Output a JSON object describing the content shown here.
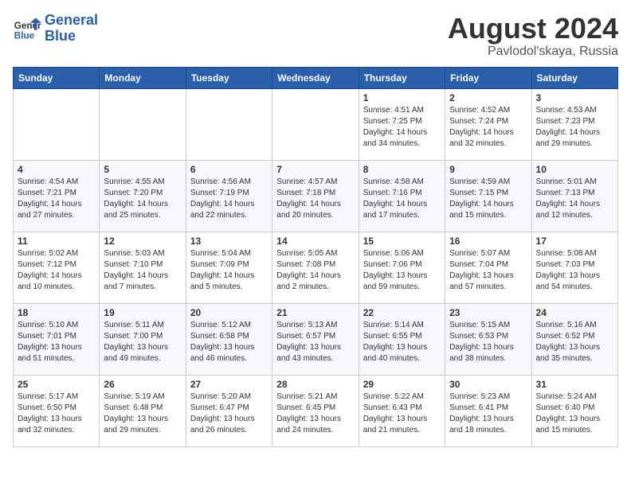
{
  "logo": {
    "text_general": "General",
    "text_blue": "Blue"
  },
  "title": "August 2024",
  "location": "Pavlodol'skaya, Russia",
  "days_of_week": [
    "Sunday",
    "Monday",
    "Tuesday",
    "Wednesday",
    "Thursday",
    "Friday",
    "Saturday"
  ],
  "weeks": [
    [
      {
        "day": "",
        "sunrise": "",
        "sunset": "",
        "daylight": ""
      },
      {
        "day": "",
        "sunrise": "",
        "sunset": "",
        "daylight": ""
      },
      {
        "day": "",
        "sunrise": "",
        "sunset": "",
        "daylight": ""
      },
      {
        "day": "",
        "sunrise": "",
        "sunset": "",
        "daylight": ""
      },
      {
        "day": "1",
        "sunrise": "Sunrise: 4:51 AM",
        "sunset": "Sunset: 7:25 PM",
        "daylight": "Daylight: 14 hours and 34 minutes."
      },
      {
        "day": "2",
        "sunrise": "Sunrise: 4:52 AM",
        "sunset": "Sunset: 7:24 PM",
        "daylight": "Daylight: 14 hours and 32 minutes."
      },
      {
        "day": "3",
        "sunrise": "Sunrise: 4:53 AM",
        "sunset": "Sunset: 7:23 PM",
        "daylight": "Daylight: 14 hours and 29 minutes."
      }
    ],
    [
      {
        "day": "4",
        "sunrise": "Sunrise: 4:54 AM",
        "sunset": "Sunset: 7:21 PM",
        "daylight": "Daylight: 14 hours and 27 minutes."
      },
      {
        "day": "5",
        "sunrise": "Sunrise: 4:55 AM",
        "sunset": "Sunset: 7:20 PM",
        "daylight": "Daylight: 14 hours and 25 minutes."
      },
      {
        "day": "6",
        "sunrise": "Sunrise: 4:56 AM",
        "sunset": "Sunset: 7:19 PM",
        "daylight": "Daylight: 14 hours and 22 minutes."
      },
      {
        "day": "7",
        "sunrise": "Sunrise: 4:57 AM",
        "sunset": "Sunset: 7:18 PM",
        "daylight": "Daylight: 14 hours and 20 minutes."
      },
      {
        "day": "8",
        "sunrise": "Sunrise: 4:58 AM",
        "sunset": "Sunset: 7:16 PM",
        "daylight": "Daylight: 14 hours and 17 minutes."
      },
      {
        "day": "9",
        "sunrise": "Sunrise: 4:59 AM",
        "sunset": "Sunset: 7:15 PM",
        "daylight": "Daylight: 14 hours and 15 minutes."
      },
      {
        "day": "10",
        "sunrise": "Sunrise: 5:01 AM",
        "sunset": "Sunset: 7:13 PM",
        "daylight": "Daylight: 14 hours and 12 minutes."
      }
    ],
    [
      {
        "day": "11",
        "sunrise": "Sunrise: 5:02 AM",
        "sunset": "Sunset: 7:12 PM",
        "daylight": "Daylight: 14 hours and 10 minutes."
      },
      {
        "day": "12",
        "sunrise": "Sunrise: 5:03 AM",
        "sunset": "Sunset: 7:10 PM",
        "daylight": "Daylight: 14 hours and 7 minutes."
      },
      {
        "day": "13",
        "sunrise": "Sunrise: 5:04 AM",
        "sunset": "Sunset: 7:09 PM",
        "daylight": "Daylight: 14 hours and 5 minutes."
      },
      {
        "day": "14",
        "sunrise": "Sunrise: 5:05 AM",
        "sunset": "Sunset: 7:08 PM",
        "daylight": "Daylight: 14 hours and 2 minutes."
      },
      {
        "day": "15",
        "sunrise": "Sunrise: 5:06 AM",
        "sunset": "Sunset: 7:06 PM",
        "daylight": "Daylight: 13 hours and 59 minutes."
      },
      {
        "day": "16",
        "sunrise": "Sunrise: 5:07 AM",
        "sunset": "Sunset: 7:04 PM",
        "daylight": "Daylight: 13 hours and 57 minutes."
      },
      {
        "day": "17",
        "sunrise": "Sunrise: 5:08 AM",
        "sunset": "Sunset: 7:03 PM",
        "daylight": "Daylight: 13 hours and 54 minutes."
      }
    ],
    [
      {
        "day": "18",
        "sunrise": "Sunrise: 5:10 AM",
        "sunset": "Sunset: 7:01 PM",
        "daylight": "Daylight: 13 hours and 51 minutes."
      },
      {
        "day": "19",
        "sunrise": "Sunrise: 5:11 AM",
        "sunset": "Sunset: 7:00 PM",
        "daylight": "Daylight: 13 hours and 49 minutes."
      },
      {
        "day": "20",
        "sunrise": "Sunrise: 5:12 AM",
        "sunset": "Sunset: 6:58 PM",
        "daylight": "Daylight: 13 hours and 46 minutes."
      },
      {
        "day": "21",
        "sunrise": "Sunrise: 5:13 AM",
        "sunset": "Sunset: 6:57 PM",
        "daylight": "Daylight: 13 hours and 43 minutes."
      },
      {
        "day": "22",
        "sunrise": "Sunrise: 5:14 AM",
        "sunset": "Sunset: 6:55 PM",
        "daylight": "Daylight: 13 hours and 40 minutes."
      },
      {
        "day": "23",
        "sunrise": "Sunrise: 5:15 AM",
        "sunset": "Sunset: 6:53 PM",
        "daylight": "Daylight: 13 hours and 38 minutes."
      },
      {
        "day": "24",
        "sunrise": "Sunrise: 5:16 AM",
        "sunset": "Sunset: 6:52 PM",
        "daylight": "Daylight: 13 hours and 35 minutes."
      }
    ],
    [
      {
        "day": "25",
        "sunrise": "Sunrise: 5:17 AM",
        "sunset": "Sunset: 6:50 PM",
        "daylight": "Daylight: 13 hours and 32 minutes."
      },
      {
        "day": "26",
        "sunrise": "Sunrise: 5:19 AM",
        "sunset": "Sunset: 6:48 PM",
        "daylight": "Daylight: 13 hours and 29 minutes."
      },
      {
        "day": "27",
        "sunrise": "Sunrise: 5:20 AM",
        "sunset": "Sunset: 6:47 PM",
        "daylight": "Daylight: 13 hours and 26 minutes."
      },
      {
        "day": "28",
        "sunrise": "Sunrise: 5:21 AM",
        "sunset": "Sunset: 6:45 PM",
        "daylight": "Daylight: 13 hours and 24 minutes."
      },
      {
        "day": "29",
        "sunrise": "Sunrise: 5:22 AM",
        "sunset": "Sunset: 6:43 PM",
        "daylight": "Daylight: 13 hours and 21 minutes."
      },
      {
        "day": "30",
        "sunrise": "Sunrise: 5:23 AM",
        "sunset": "Sunset: 6:41 PM",
        "daylight": "Daylight: 13 hours and 18 minutes."
      },
      {
        "day": "31",
        "sunrise": "Sunrise: 5:24 AM",
        "sunset": "Sunset: 6:40 PM",
        "daylight": "Daylight: 13 hours and 15 minutes."
      }
    ]
  ]
}
